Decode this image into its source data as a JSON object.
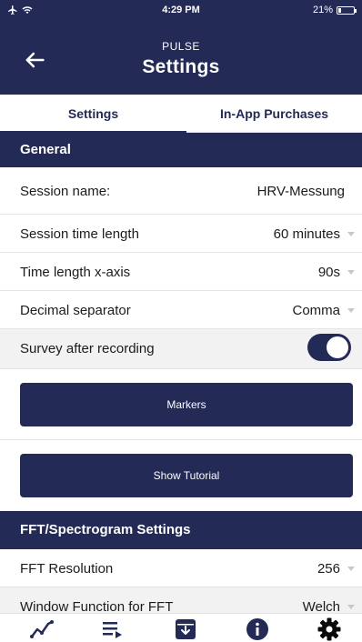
{
  "status_bar": {
    "time": "4:29 PM",
    "battery_text": "21%",
    "battery_level": 0.21
  },
  "header": {
    "app_name": "PULSE",
    "title": "Settings"
  },
  "tabs": [
    {
      "label": "Settings",
      "active": true
    },
    {
      "label": "In-App Purchases",
      "active": false
    }
  ],
  "general": {
    "title": "General",
    "session_name": {
      "label": "Session name:",
      "value": "HRV-Messung"
    },
    "session_time_length": {
      "label": "Session time length",
      "value": "60 minutes"
    },
    "time_length_x_axis": {
      "label": "Time length x-axis",
      "value": "90s"
    },
    "decimal_separator": {
      "label": "Decimal separator",
      "value": "Comma"
    },
    "survey_after_recording": {
      "label": "Survey after recording",
      "enabled": true
    },
    "markers_button": "Markers",
    "show_tutorial_button": "Show Tutorial"
  },
  "fft": {
    "title": "FFT/Spectrogram Settings",
    "fft_resolution": {
      "label": "FFT Resolution",
      "value": "256"
    },
    "window_function": {
      "label": "Window Function for FFT",
      "value": "Welch"
    }
  },
  "bottom_nav": [
    {
      "icon": "chart-icon"
    },
    {
      "icon": "playlist-icon"
    },
    {
      "icon": "archive-icon"
    },
    {
      "icon": "info-icon"
    },
    {
      "icon": "gear-icon",
      "active": true
    }
  ],
  "colors": {
    "primary": "#232a55",
    "row_alt": "#f2f2f2",
    "caret": "#c8c8c8"
  }
}
